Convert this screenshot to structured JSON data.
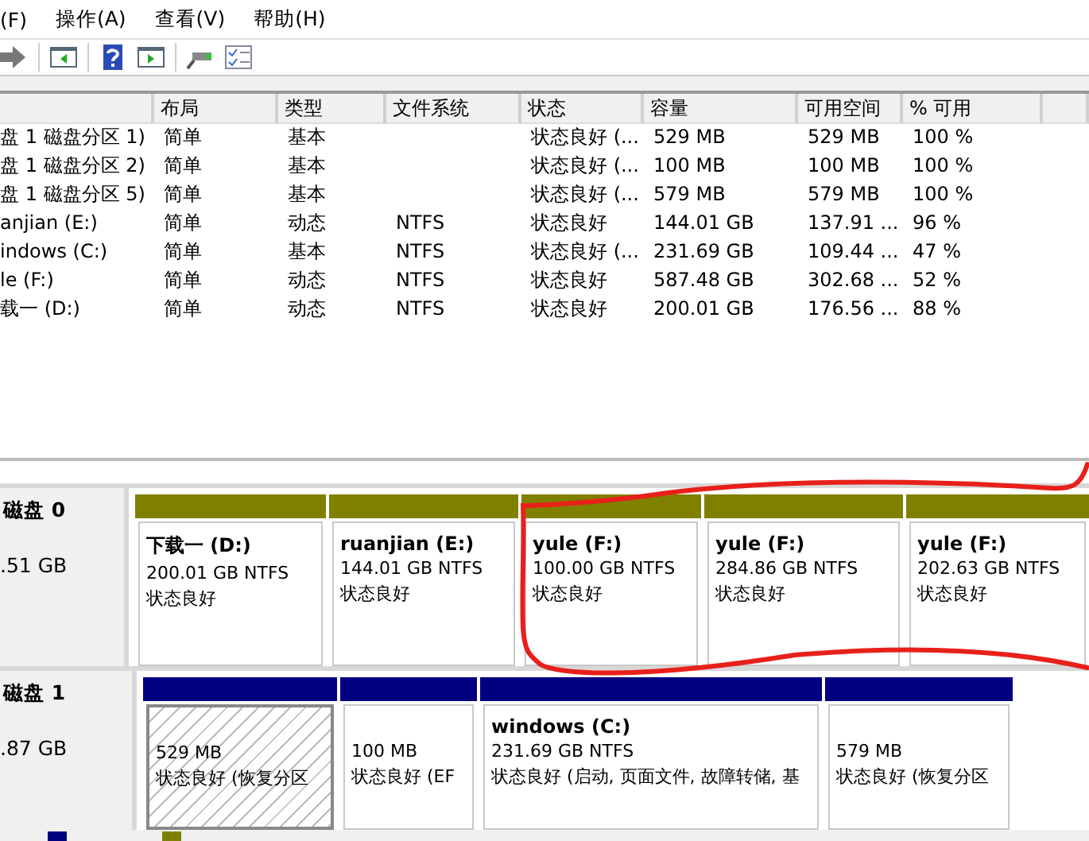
{
  "menu": [
    "(F)",
    "操作(A)",
    "查看(V)",
    "帮助(H)"
  ],
  "volumes": {
    "columns": [
      "布局",
      "类型",
      "文件系统",
      "状态",
      "容量",
      "可用空间",
      "% 可用"
    ],
    "rows": [
      {
        "name": "盘 1 磁盘分区 1)",
        "layout": "简单",
        "type": "基本",
        "status": "状态良好 (...",
        "capacity": "529 MB",
        "free": "529 MB",
        "percent": "100 %"
      },
      {
        "name": "盘 1 磁盘分区 2)",
        "layout": "简单",
        "type": "基本",
        "status": "状态良好 (...",
        "capacity": "100 MB",
        "free": "100 MB",
        "percent": "100 %"
      },
      {
        "name": "盘 1 磁盘分区 5)",
        "layout": "简单",
        "type": "基本",
        "status": "状态良好 (...",
        "capacity": "579 MB",
        "free": "579 MB",
        "percent": "100 %"
      },
      {
        "name": "anjian (E:)",
        "layout": "简单",
        "type": "动态",
        "filesystem": "NTFS",
        "status": "状态良好",
        "capacity": "144.01 GB",
        "free": "137.91 ...",
        "percent": "96 %"
      },
      {
        "name": "indows (C:)",
        "layout": "简单",
        "type": "基本",
        "filesystem": "NTFS",
        "status": "状态良好 (...",
        "capacity": "231.69 GB",
        "free": "109.44 ...",
        "percent": "47 %"
      },
      {
        "name": "le (F:)",
        "layout": "简单",
        "type": "动态",
        "filesystem": "NTFS",
        "status": "状态良好",
        "capacity": "587.48 GB",
        "free": "302.68 ...",
        "percent": "52 %"
      },
      {
        "name": "载一 (D:)",
        "layout": "简单",
        "type": "动态",
        "filesystem": "NTFS",
        "status": "状态良好",
        "capacity": "200.01 GB",
        "free": "176.56 ...",
        "percent": "88 %"
      }
    ]
  },
  "disks": [
    {
      "name": "磁盘 0",
      "size": ".51 GB",
      "partitions": [
        {
          "kind": "simple",
          "selected": false,
          "title": "下载一 (D:)",
          "detail": "200.01 GB NTFS",
          "status": "状态良好"
        },
        {
          "kind": "simple",
          "selected": false,
          "title": "ruanjian (E:)",
          "detail": "144.01 GB NTFS",
          "status": "状态良好"
        },
        {
          "kind": "simple",
          "selected": false,
          "title": "yule (F:)",
          "detail": "100.00 GB NTFS",
          "status": "状态良好"
        },
        {
          "kind": "simple",
          "selected": false,
          "title": "yule (F:)",
          "detail": "284.86 GB NTFS",
          "status": "状态良好"
        },
        {
          "kind": "simple",
          "selected": false,
          "title": "yule (F:)",
          "detail": "202.63 GB NTFS",
          "status": "状态良好"
        }
      ]
    },
    {
      "name": "磁盘 1",
      "size": ".87 GB",
      "partitions": [
        {
          "kind": "primary",
          "selected": true,
          "detail": "529 MB",
          "status": "状态良好 (恢复分区"
        },
        {
          "kind": "primary",
          "selected": false,
          "detail": "100 MB",
          "status": "状态良好 (EF"
        },
        {
          "kind": "primary",
          "selected": false,
          "title": "windows (C:)",
          "detail": "231.69 GB NTFS",
          "status": "状态良好 (启动, 页面文件, 故障转储, 基"
        },
        {
          "kind": "primary",
          "selected": false,
          "detail": "579 MB",
          "status": "状态良好 (恢复分区"
        }
      ]
    }
  ]
}
